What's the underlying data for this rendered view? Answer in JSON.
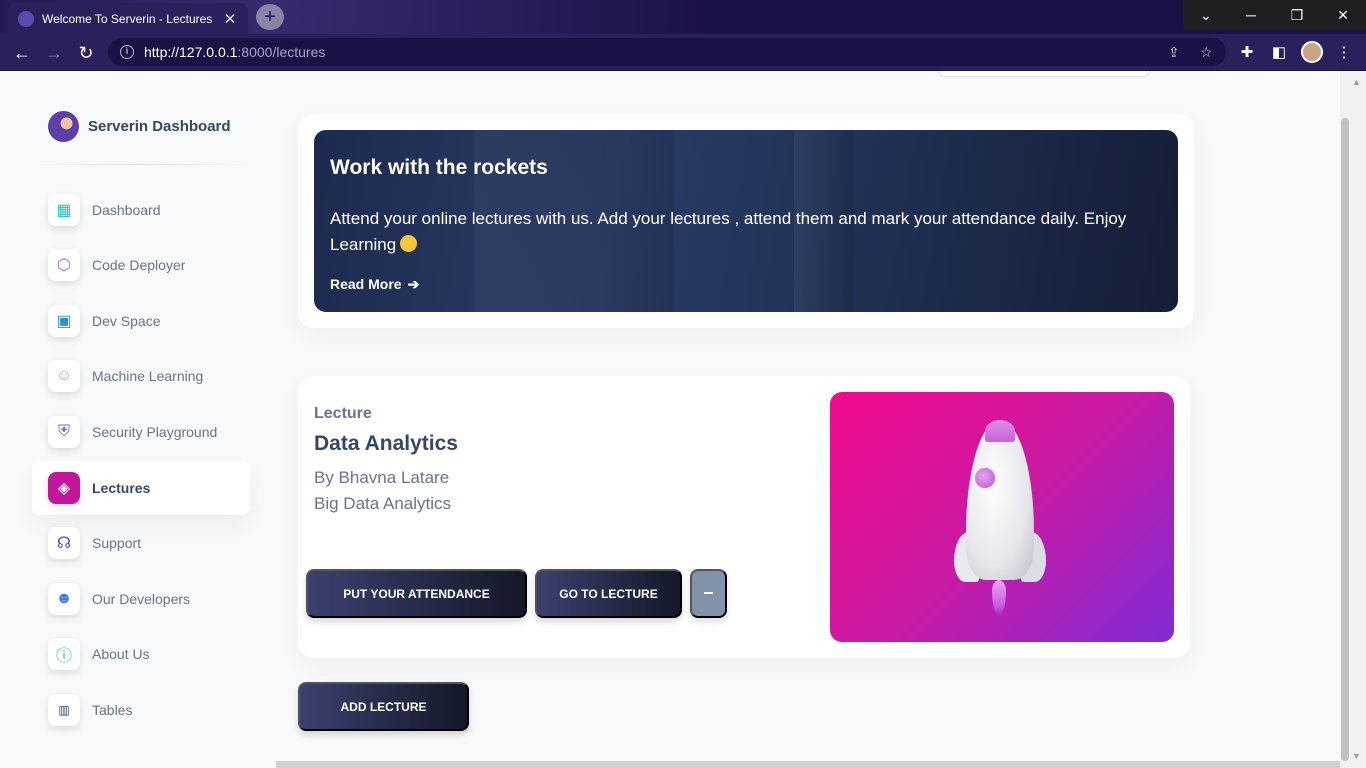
{
  "browser": {
    "tab_title": "Welcome To Serverin - Lectures",
    "tab_close": "✕",
    "new_tab": "+",
    "url_host": "http://127.0.0.1",
    "url_rest": ":8000/lectures"
  },
  "sidebar": {
    "brand": "Serverin Dashboard",
    "items": [
      {
        "label": "Dashboard",
        "icon": "dashboard-grid-icon"
      },
      {
        "label": "Code Deployer",
        "icon": "code-deployer-icon"
      },
      {
        "label": "Dev Space",
        "icon": "dev-space-icon"
      },
      {
        "label": "Machine Learning",
        "icon": "machine-learning-icon"
      },
      {
        "label": "Security Playground",
        "icon": "security-icon"
      },
      {
        "label": "Lectures",
        "icon": "lectures-icon",
        "active": true
      },
      {
        "label": "Support",
        "icon": "headset-icon"
      },
      {
        "label": "Our Developers",
        "icon": "developer-icon"
      },
      {
        "label": "About Us",
        "icon": "info-icon"
      },
      {
        "label": "Tables",
        "icon": "tables-icon"
      }
    ]
  },
  "hero": {
    "title": "Work with the rockets",
    "text": "Attend your online lectures with us. Add your lectures , attend them and mark your attendance daily. Enjoy Learning",
    "link": "Read More"
  },
  "lecture": {
    "kicker": "Lecture",
    "title": "Data Analytics",
    "author": "By Bhavna Latare",
    "subject": "Big Data Analytics",
    "attendance_button": "PUT YOUR ATTENDANCE",
    "goto_button": "GO TO LECTURE",
    "remove_button": "−"
  },
  "add_lecture_button": "ADD LECTURE",
  "colors": {
    "accent_pink": "#c2179b",
    "button_dark": "#3a416f",
    "text_heading": "#344767",
    "text_muted": "#67748e"
  }
}
